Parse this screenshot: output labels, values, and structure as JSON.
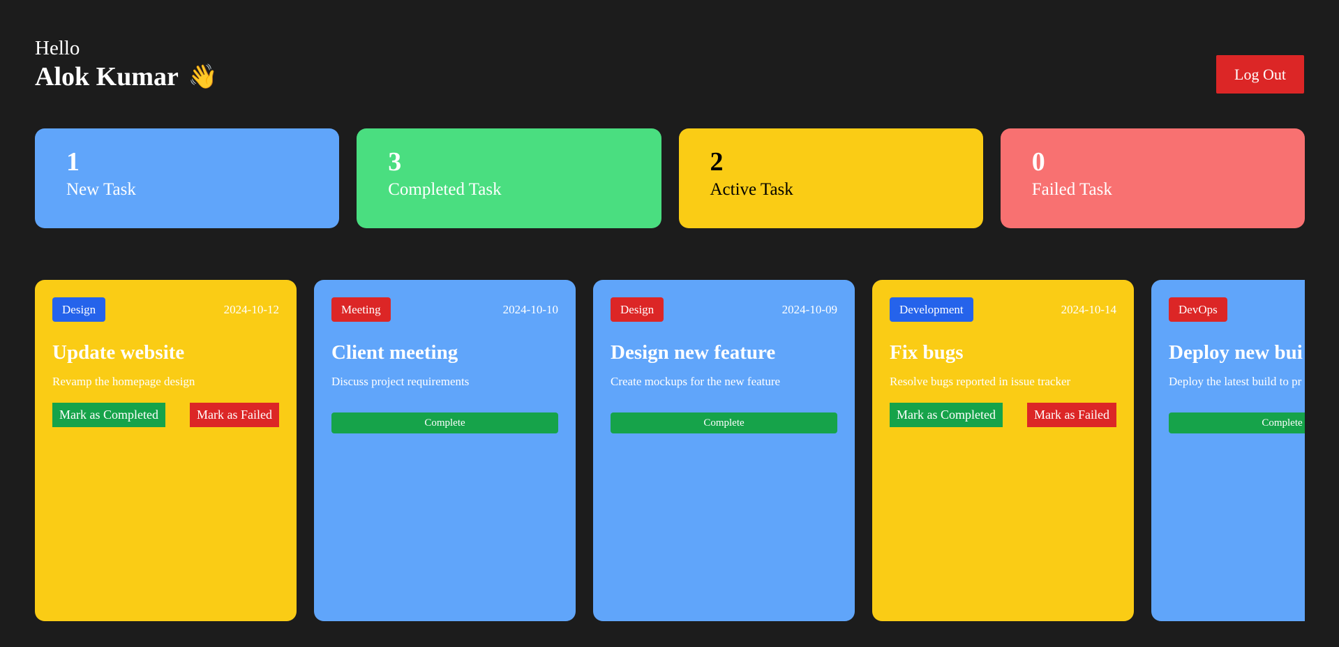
{
  "header": {
    "greeting": "Hello",
    "user_name": "Alok Kumar",
    "wave_emoji": "👋",
    "logout_label": "Log Out"
  },
  "stats": [
    {
      "count": "1",
      "label": "New Task",
      "bg": "#60a5fa",
      "fg": "#ffffff"
    },
    {
      "count": "3",
      "label": "Completed Task",
      "bg": "#4ade80",
      "fg": "#ffffff"
    },
    {
      "count": "2",
      "label": "Active Task",
      "bg": "#facc15",
      "fg": "#000000"
    },
    {
      "count": "0",
      "label": "Failed Task",
      "bg": "#f87171",
      "fg": "#ffffff"
    }
  ],
  "tasks": [
    {
      "category": "Design",
      "category_color": "#2563eb",
      "date": "2024-10-12",
      "title": "Update website",
      "description": "Revamp the homepage design",
      "bg": "#facc15",
      "status": "active",
      "completed_label": "Mark as Completed",
      "failed_label": "Mark as Failed"
    },
    {
      "category": "Meeting",
      "category_color": "#dc2626",
      "date": "2024-10-10",
      "title": "Client meeting",
      "description": "Discuss project requirements",
      "bg": "#60a5fa",
      "status": "completed",
      "complete_label": "Complete"
    },
    {
      "category": "Design",
      "category_color": "#dc2626",
      "date": "2024-10-09",
      "title": "Design new feature",
      "description": "Create mockups for the new feature",
      "bg": "#60a5fa",
      "status": "completed",
      "complete_label": "Complete"
    },
    {
      "category": "Development",
      "category_color": "#2563eb",
      "date": "2024-10-14",
      "title": "Fix bugs",
      "description": "Resolve bugs reported in issue tracker",
      "bg": "#facc15",
      "status": "active",
      "completed_label": "Mark as Completed",
      "failed_label": "Mark as Failed"
    },
    {
      "category": "DevOps",
      "category_color": "#dc2626",
      "date": "",
      "title": "Deploy new bui",
      "description": "Deploy the latest build to pr",
      "bg": "#60a5fa",
      "status": "completed",
      "complete_label": "Complete"
    }
  ]
}
